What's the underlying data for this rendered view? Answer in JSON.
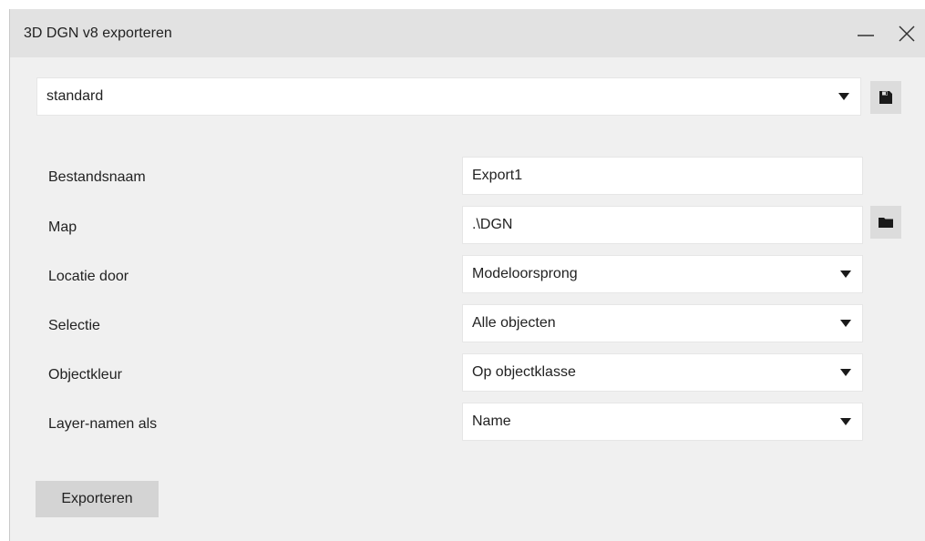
{
  "window": {
    "title": "3D DGN v8 exporteren"
  },
  "preset": {
    "value": "standard"
  },
  "form": {
    "rows": [
      {
        "label": "Bestandsnaam",
        "value": "Export1"
      },
      {
        "label": "Map",
        "value": ".\\DGN"
      },
      {
        "label": "Locatie door",
        "value": "Modeloorsprong"
      },
      {
        "label": "Selectie",
        "value": "Alle objecten"
      },
      {
        "label": "Objectkleur",
        "value": "Op objectklasse"
      },
      {
        "label": "Layer-namen als",
        "value": "Name"
      }
    ]
  },
  "actions": {
    "export_label": "Exporteren"
  },
  "icons": {
    "minimize": "minimize-icon",
    "close": "close-icon",
    "save": "floppy-disk-icon",
    "folder": "folder-icon",
    "dropdown": "triangle-down-icon"
  },
  "colors": {
    "window_bg": "#f0f0f0",
    "titlebar_bg": "#e2e2e2",
    "field_bg": "#ffffff",
    "button_bg": "#d4d4d4",
    "icon_button_bg": "#dcdcdc"
  }
}
